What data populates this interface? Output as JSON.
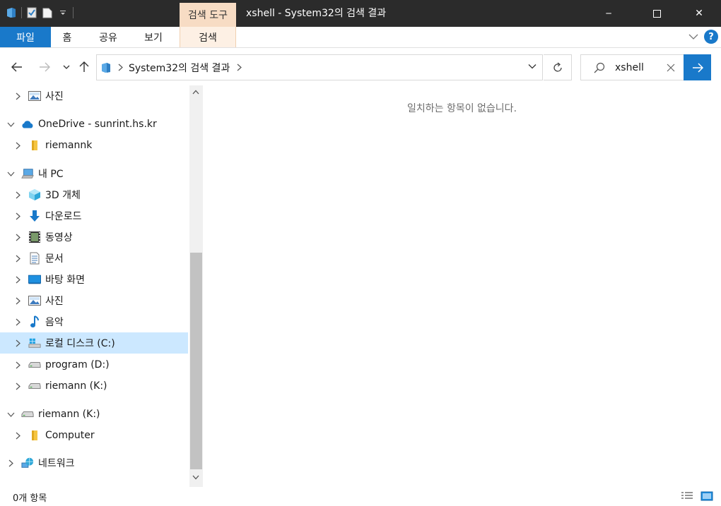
{
  "titlebar": {
    "context_tab": "검색 도구",
    "title": "xshell - System32의 검색 결과",
    "minimize_glyph": "─",
    "close_glyph": "✕"
  },
  "ribbon": {
    "tabs": [
      {
        "label": "파일"
      },
      {
        "label": "홈"
      },
      {
        "label": "공유"
      },
      {
        "label": "보기"
      },
      {
        "label": "검색"
      }
    ],
    "help_glyph": "?"
  },
  "address": {
    "path": "System32의 검색 결과"
  },
  "search": {
    "value": "xshell"
  },
  "nav_tree": [
    {
      "label": "사진",
      "icon": "pictures-icon"
    },
    {
      "label": "OneDrive - sunrint.hs.kr",
      "icon": "onedrive-icon"
    },
    {
      "label": "riemannk",
      "icon": "folder-icon"
    },
    {
      "label": "내 PC",
      "icon": "this-pc-icon"
    },
    {
      "label": "3D 개체",
      "icon": "3d-objects-icon"
    },
    {
      "label": "다운로드",
      "icon": "downloads-icon"
    },
    {
      "label": "동영상",
      "icon": "videos-icon"
    },
    {
      "label": "문서",
      "icon": "documents-icon"
    },
    {
      "label": "바탕 화면",
      "icon": "desktop-icon"
    },
    {
      "label": "사진",
      "icon": "pictures-icon"
    },
    {
      "label": "음악",
      "icon": "music-icon"
    },
    {
      "label": "로컬 디스크 (C:)",
      "icon": "windows-drive-icon"
    },
    {
      "label": "program (D:)",
      "icon": "drive-icon"
    },
    {
      "label": "riemann (K:)",
      "icon": "drive-icon"
    },
    {
      "label": "riemann (K:)",
      "icon": "drive-icon"
    },
    {
      "label": "Computer",
      "icon": "folder-icon"
    },
    {
      "label": "네트워크",
      "icon": "network-icon"
    }
  ],
  "content": {
    "empty_message": "일치하는 항목이 없습니다."
  },
  "status": {
    "item_count": "0개 항목"
  },
  "colors": {
    "accent": "#1979ca",
    "selection": "#cce8ff",
    "context_tab": "#f7dcc4",
    "titlebar": "#2b2b2b"
  }
}
